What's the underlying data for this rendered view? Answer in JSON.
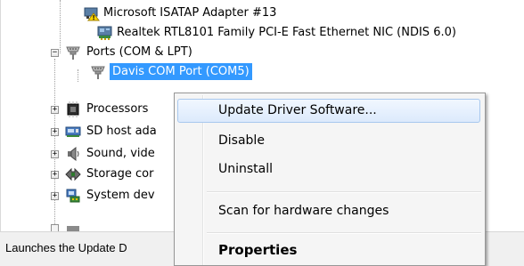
{
  "tree": {
    "items": [
      {
        "label": "Microsoft ISATAP Adapter #13",
        "icon": "network-adapter-warning-icon"
      },
      {
        "label": "Realtek RTL8101 Family PCI-E Fast Ethernet NIC (NDIS 6.0)",
        "icon": "network-adapter-icon"
      },
      {
        "label": "Ports (COM & LPT)",
        "icon": "port-connector-icon",
        "toggle": "−"
      },
      {
        "label": "Davis COM Port (COM5)",
        "icon": "port-connector-icon",
        "selected": true
      },
      {
        "label": "Processors",
        "icon": "processor-chip-icon",
        "toggle": "+"
      },
      {
        "label": "SD host ada",
        "icon": "sd-host-adapter-icon",
        "toggle": "+"
      },
      {
        "label": "Sound, vide",
        "icon": "speaker-icon",
        "toggle": "+"
      },
      {
        "label": "Storage cor",
        "icon": "storage-controller-icon",
        "toggle": "+"
      },
      {
        "label": "System dev",
        "icon": "system-devices-icon",
        "toggle": "+"
      }
    ]
  },
  "context_menu": {
    "items": [
      {
        "label": "Update Driver Software...",
        "highlighted": true
      },
      {
        "label": "Disable"
      },
      {
        "label": "Uninstall"
      },
      {
        "label": "Scan for hardware changes"
      },
      {
        "label": "Properties",
        "bold": true
      }
    ]
  },
  "status_bar": {
    "text": "Launches the Update D"
  },
  "colors": {
    "selection": "#3399ff",
    "menu_hover": "#dceafc",
    "status_bar": "#f0f0f0"
  }
}
